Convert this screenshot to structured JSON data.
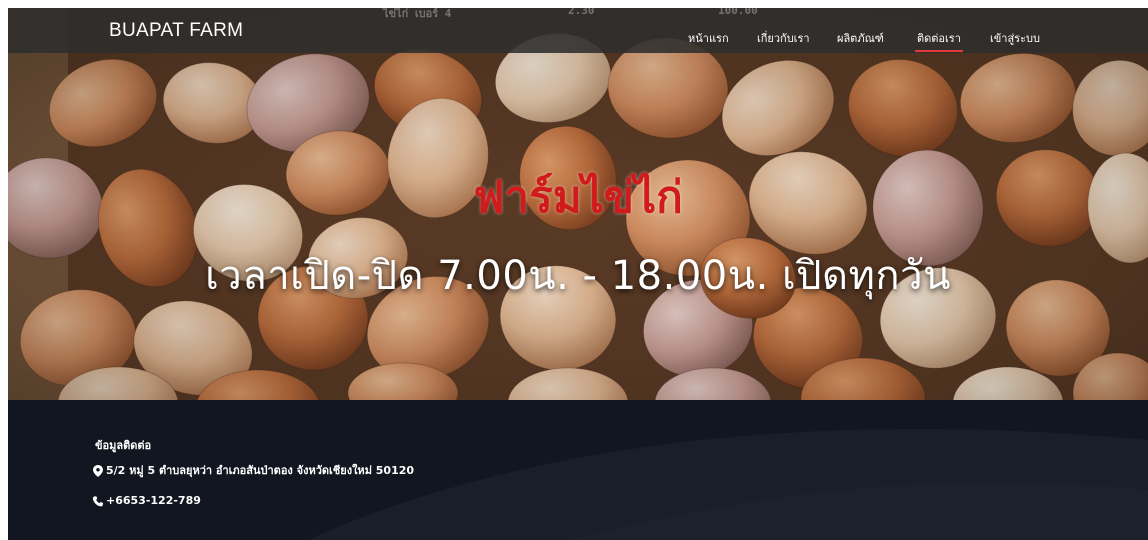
{
  "header": {
    "brand": "BUAPAT FARM",
    "ghost_text": {
      "item": "ไข่ไก่ เบอร์ 4",
      "qty": "2.30",
      "price": "100.00"
    },
    "nav": [
      {
        "label": "หน้าแรก",
        "active": false
      },
      {
        "label": "เกี่ยวกับเรา",
        "active": false
      },
      {
        "label": "ผลิตภัณฑ์",
        "active": false
      },
      {
        "label": "ติดต่อเรา",
        "active": true
      },
      {
        "label": "เข้าสู่ระบบ",
        "active": false
      }
    ]
  },
  "hero": {
    "title": "ฟาร์มไข่ไก่",
    "hours": "เวลาเปิด-ปิด 7.00น. - 18.00น. เปิดทุกวัน"
  },
  "footer": {
    "heading": "ข้อมูลติดต่อ",
    "address": "5/2 หมู่ 5 ตำบลยุหว่า อำเภอสันป่าตอง จังหวัดเชียงใหม่ 50120",
    "phone": "+6653-122-789",
    "address_icon": "map-marker-icon",
    "phone_icon": "phone-icon"
  },
  "colors": {
    "title_red": "#d11a1a",
    "nav_active_underline": "#e03a3a",
    "footer_bg": "#121620",
    "navbar_bg": "#2d2d2d"
  }
}
